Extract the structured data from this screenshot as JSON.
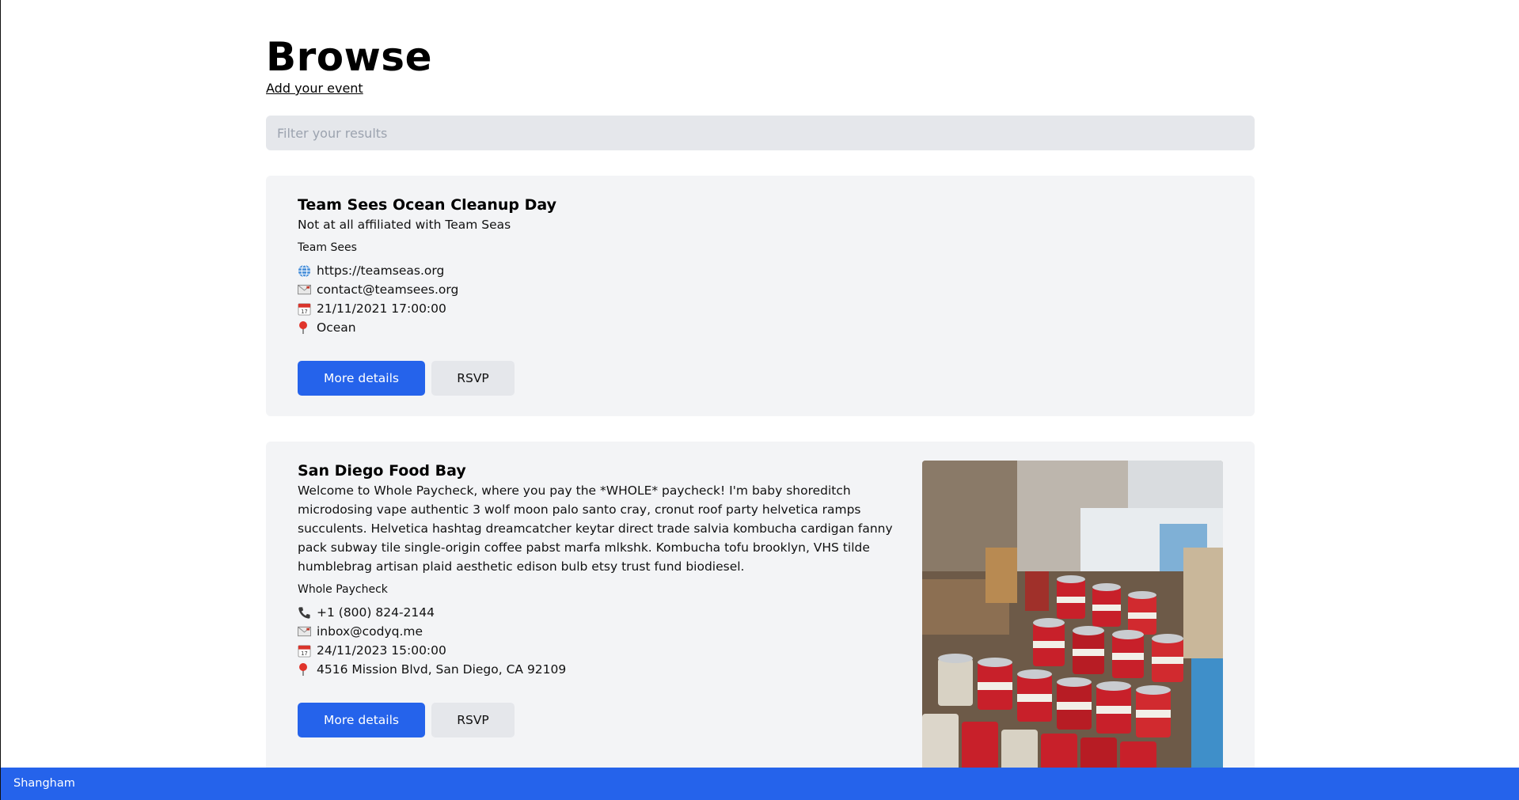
{
  "page": {
    "title": "Browse",
    "add_event_link": "Add your event"
  },
  "filter": {
    "placeholder": "Filter your results",
    "value": ""
  },
  "events": [
    {
      "title": "Team Sees Ocean Cleanup Day",
      "description": "Not at all affiliated with Team Seas",
      "organizer": "Team Sees",
      "website": "https://teamseas.org",
      "email": "contact@teamsees.org",
      "datetime": "21/11/2021 17:00:00",
      "location": "Ocean",
      "more_details_label": "More details",
      "rsvp_label": "RSVP"
    },
    {
      "title": "San Diego Food Bay",
      "description": "Welcome to Whole Paycheck, where you pay the *WHOLE* paycheck! I'm baby shoreditch microdosing vape authentic 3 wolf moon palo santo cray, cronut roof party helvetica ramps succulents. Helvetica hashtag dreamcatcher keytar direct trade salvia kombucha cardigan fanny pack subway tile single-origin coffee pabst marfa mlkshk. Kombucha tofu brooklyn, VHS tilde humblebrag artisan plaid aesthetic edison bulb etsy trust fund biodiesel.",
      "organizer": "Whole Paycheck",
      "phone": "+1 (800) 824-2144",
      "email": "inbox@codyq.me",
      "datetime": "24/11/2023 15:00:00",
      "location": "4516 Mission Blvd, San Diego, CA 92109",
      "more_details_label": "More details",
      "rsvp_label": "RSVP",
      "image": "food-bank-canned-goods-photo"
    }
  ],
  "icons": {
    "website": "globe-icon",
    "email": "envelope-icon",
    "date": "calendar-icon",
    "location": "pin-icon",
    "phone": "phone-icon"
  },
  "statusbar": {
    "text": "Shangham"
  },
  "colors": {
    "primary": "#2563eb",
    "card_bg": "#f3f4f6",
    "input_bg": "#e5e7eb"
  }
}
